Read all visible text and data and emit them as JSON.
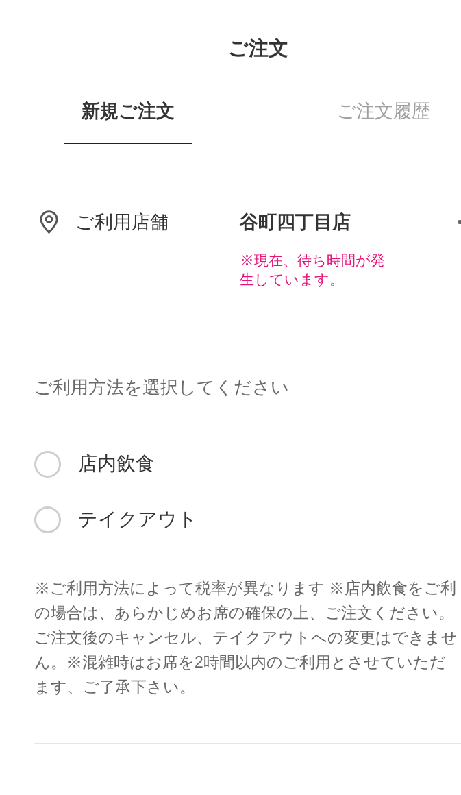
{
  "header": {
    "title": "ご注文"
  },
  "tabs": [
    {
      "label": "新規ご注文",
      "selected": true
    },
    {
      "label": "ご注文履歴",
      "selected": false
    }
  ],
  "store": {
    "label": "ご利用店舗",
    "name": "谷町四丁目店",
    "notice_lines": [
      "※現在、待ち時間が発",
      "生しています。"
    ]
  },
  "usage": {
    "prompt": "ご利用方法を選択してください",
    "options": [
      {
        "label": "店内飲食",
        "selected": false
      },
      {
        "label": "テイクアウト",
        "selected": false
      }
    ],
    "note_lines": [
      "※ご利用方法によって税率が異なります ※店内飲食をご利",
      "の場合は、あらかじめお席の確保の上、ご注文ください。",
      "ご注文後のキャンセル、テイクアウトへの変更はできませ",
      "ん。※混雑時はお席を2時間以内のご利用とさせていただ",
      "ます、ご了承下さい。"
    ]
  }
}
